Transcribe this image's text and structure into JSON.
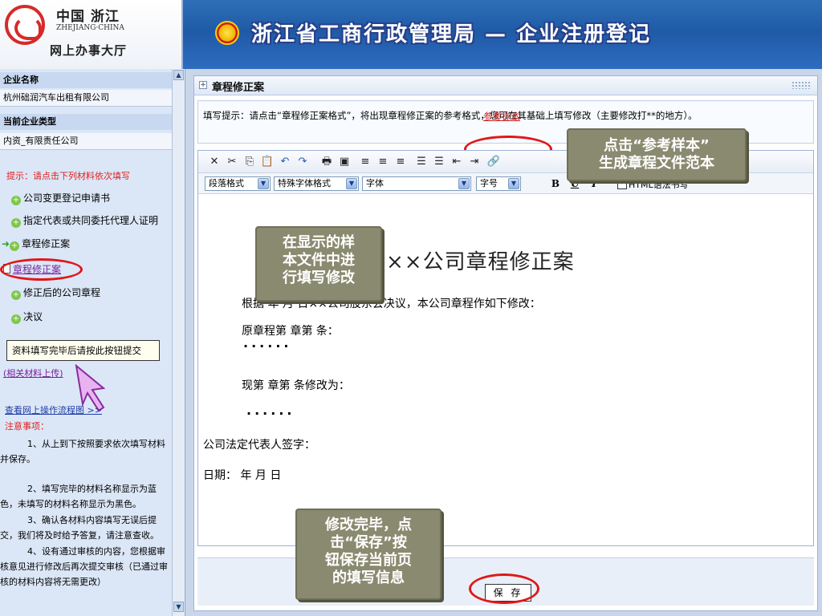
{
  "header": {
    "logo_cn": "中国 浙江",
    "logo_en": "ZHEJIANG·CHINA",
    "logo_hall": "网上办事大厅",
    "title": "浙江省工商行政管理局 — 企业注册登记"
  },
  "sidebar": {
    "company_name_label": "企业名称",
    "company_name": "杭州础润汽车出租有限公司",
    "company_type_label": "当前企业类型",
    "company_type": "内资_有限责任公司",
    "tip": "提示：请点击下列材料依次填写",
    "materials": [
      "公司变更登记申请书",
      "指定代表或共同委托代理人证明",
      "章程修正案",
      "章程修正案",
      "修正后的公司章程",
      "决议"
    ],
    "tooltip": "资料填写完毕后请按此按钮提交",
    "upload_link": "(相关材料上传)",
    "flow_link": "查看网上操作流程图 >>",
    "notes_title": "注意事项：",
    "notes": [
      "1、从上到下按照要求依次填写材料并保存。",
      "2、填写完毕的材料名称显示为蓝色，未填写的材料名称显示为黑色。",
      "3、确认各材料内容填写无误后提交，我们将及时给予答复，请注意查收。",
      "4、设有通过审核的内容，您根据审核意见进行修改后再次提交审核（已通过审核的材料内容将无需更改）"
    ]
  },
  "panel": {
    "title": "章程修正案",
    "hint": "填写提示：请点击“章程修正案格式”，将出现章程修正案的参考格式，您可在其基础上填写修改（主要修改打**的地方）。",
    "sample_link": "参考样本"
  },
  "toolbar": {
    "para_format": "段落格式",
    "special_format": "特殊字体格式",
    "font": "字体",
    "font_size": "字号",
    "bold": "B",
    "underline": "U",
    "italic": "I",
    "html_label": "HTML语法书写"
  },
  "document": {
    "title": "××公司章程修正案",
    "line1": "根据 年 月 日××公司股东会决议，本公司章程作如下修改：",
    "line2": "原章程第 章第 条：",
    "dots": "······",
    "line3": "现第 章第 条修改为：",
    "line4": "公司法定代表人签字：",
    "line5": "日期：  年 月 日"
  },
  "save_label": "保 存",
  "callouts": {
    "sample": [
      "点击“参考样本”",
      "生成章程文件范本"
    ],
    "edit": [
      "在显示的样",
      "本文件中进",
      "行填写修改"
    ],
    "save": [
      "修改完毕，点",
      "击“保存”按",
      "钮保存当前页",
      "的填写信息"
    ]
  }
}
